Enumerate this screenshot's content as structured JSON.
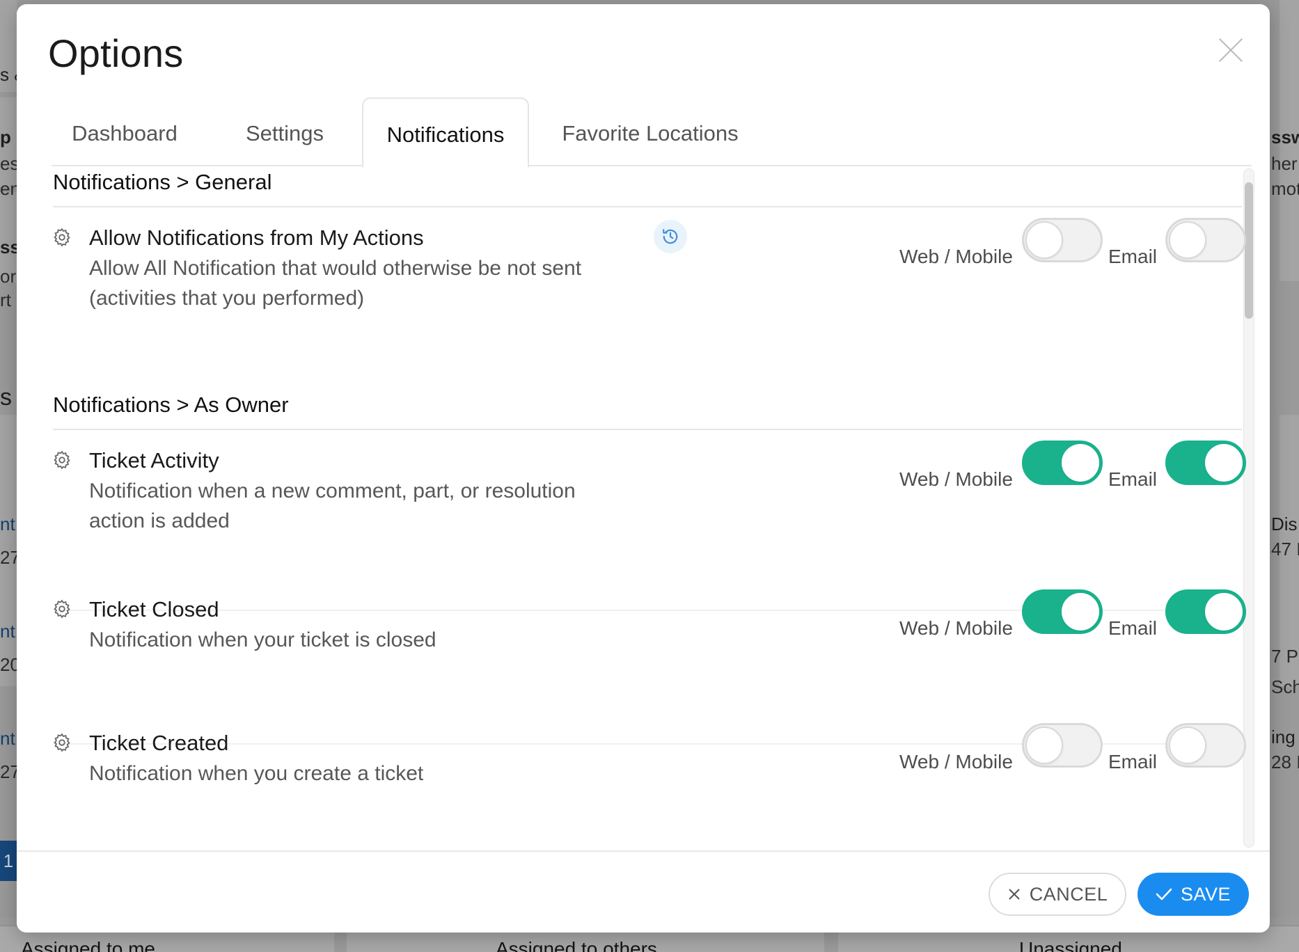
{
  "background": {
    "fragments": [
      "s &",
      "p",
      "es",
      "en",
      "ssu",
      "or",
      "rt",
      "s /",
      "nt",
      "27",
      "nt",
      "20",
      "nt",
      "27",
      "sswo",
      "her",
      "mot",
      "Dis",
      "47 I",
      "7 P",
      "Scho",
      "ing",
      "28 I"
    ],
    "page_number": "1",
    "bottom_tabs": [
      "Assigned to me",
      "Assigned to others",
      "Unassigned"
    ]
  },
  "modal": {
    "title": "Options",
    "tabs": [
      {
        "label": "Dashboard",
        "active": false
      },
      {
        "label": "Settings",
        "active": false
      },
      {
        "label": "Notifications",
        "active": true
      },
      {
        "label": "Favorite Locations",
        "active": false
      }
    ],
    "channel_labels": {
      "web": "Web / Mobile",
      "email": "Email"
    },
    "sections": [
      {
        "title": "Notifications > General",
        "items": [
          {
            "title": "Allow Notifications from My Actions",
            "description": "Allow All Notification that would otherwise be not sent (activities that you performed)",
            "web_enabled": false,
            "email_enabled": false,
            "has_history_icon": true
          }
        ]
      },
      {
        "title": "Notifications > As Owner",
        "items": [
          {
            "title": "Ticket Activity",
            "description": "Notification when a new comment, part, or resolution action is added",
            "web_enabled": true,
            "email_enabled": true
          },
          {
            "title": "Ticket Closed",
            "description": "Notification when your ticket is closed",
            "web_enabled": true,
            "email_enabled": true
          },
          {
            "title": "Ticket Created",
            "description": "Notification when you create a ticket",
            "web_enabled": false,
            "email_enabled": false
          }
        ]
      }
    ],
    "footer": {
      "cancel_label": "CANCEL",
      "save_label": "SAVE"
    }
  },
  "colors": {
    "toggle_on": "#19b28d",
    "save_button": "#1a8cf0",
    "history_icon": "#3d8fd6"
  }
}
